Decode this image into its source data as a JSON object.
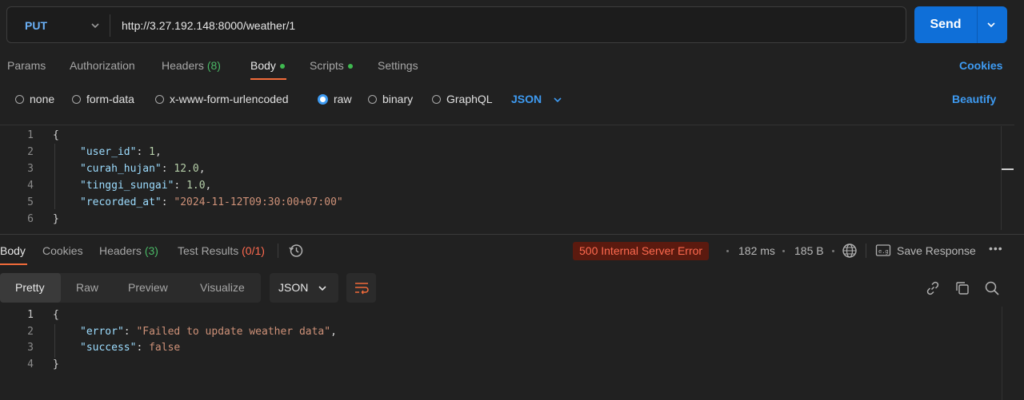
{
  "request": {
    "method": "PUT",
    "url": "http://3.27.192.148:8000/weather/1",
    "send_label": "Send"
  },
  "req_tabs": {
    "params": "Params",
    "authorization": "Authorization",
    "headers": "Headers",
    "headers_count": "(8)",
    "body": "Body",
    "scripts": "Scripts",
    "settings": "Settings",
    "cookies": "Cookies"
  },
  "body_types": {
    "none": "none",
    "form_data": "form-data",
    "urlencoded": "x-www-form-urlencoded",
    "raw": "raw",
    "binary": "binary",
    "graphql": "GraphQL",
    "format": "JSON",
    "beautify": "Beautify",
    "selected": "raw"
  },
  "request_body": {
    "lines": [
      "1",
      "2",
      "3",
      "4",
      "5",
      "6"
    ],
    "open": "{",
    "close": "}",
    "fields": [
      {
        "key": "\"user_id\"",
        "value": "1",
        "type": "num"
      },
      {
        "key": "\"curah_hujan\"",
        "value": "12.0",
        "type": "num"
      },
      {
        "key": "\"tinggi_sungai\"",
        "value": "1.0",
        "type": "num"
      },
      {
        "key": "\"recorded_at\"",
        "value": "\"2024-11-12T09:30:00+07:00\"",
        "type": "str"
      }
    ]
  },
  "response_tabs": {
    "body": "Body",
    "cookies": "Cookies",
    "headers": "Headers",
    "headers_count": "(3)",
    "test_results": "Test Results",
    "test_count": "(0/1)"
  },
  "response_meta": {
    "status": "500 Internal Server Error",
    "time": "182 ms",
    "size": "185 B",
    "save_response": "Save Response",
    "more": "•••"
  },
  "response_view": {
    "pretty": "Pretty",
    "raw": "Raw",
    "preview": "Preview",
    "visualize": "Visualize",
    "format": "JSON"
  },
  "response_body": {
    "lines": [
      "1",
      "2",
      "3",
      "4"
    ],
    "open": "{",
    "close": "}",
    "fields": [
      {
        "key": "\"error\"",
        "value": "\"Failed to update weather data\"",
        "type": "str"
      },
      {
        "key": "\"success\"",
        "value": "false",
        "type": "bool"
      }
    ]
  },
  "colors": {
    "accent_blue": "#0f6fd8",
    "active_underline": "#f26b3a",
    "error_status": "#ff6a4f",
    "count_green": "#4ab866"
  }
}
